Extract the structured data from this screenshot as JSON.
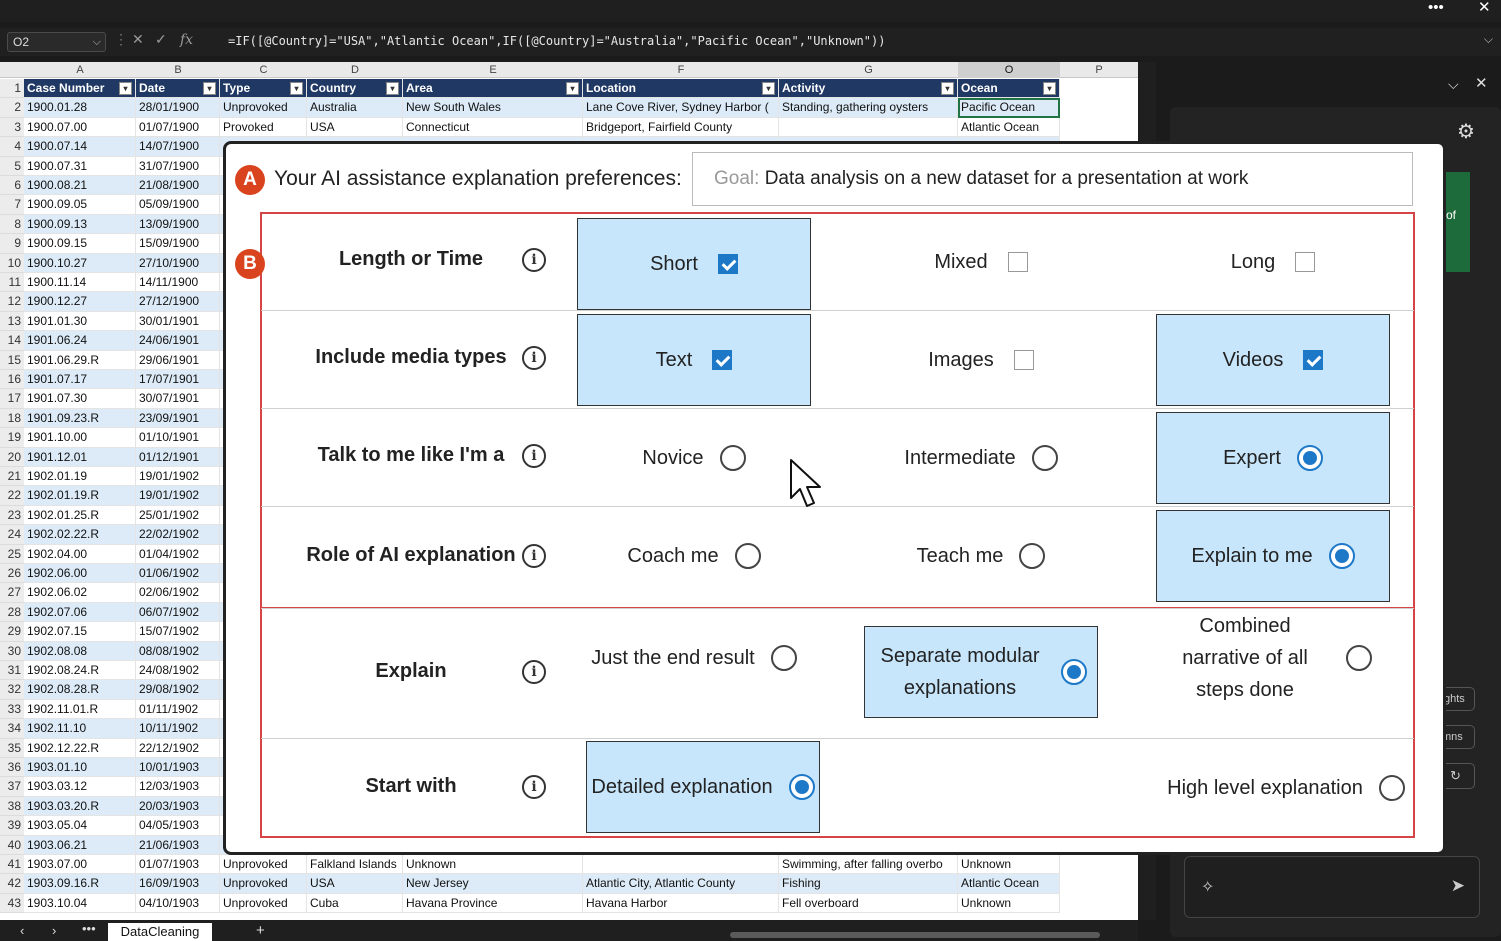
{
  "window": {
    "more_icon": "ellipsis-icon",
    "close_glyph": "✕"
  },
  "formula_bar": {
    "name_box": "O2",
    "formula": "=IF([@Country]=\"USA\",\"Atlantic Ocean\",IF([@Country]=\"Australia\",\"Pacific Ocean\",\"Unknown\"))"
  },
  "sheet": {
    "columns": [
      "A",
      "B",
      "C",
      "D",
      "E",
      "F",
      "G",
      "O",
      "P"
    ],
    "headers": [
      "Case Number",
      "Date",
      "Type",
      "Country",
      "Area",
      "Location",
      "Activity",
      "Ocean"
    ],
    "rows_top": [
      {
        "n": "1"
      },
      {
        "n": "2",
        "cells": [
          "1900.01.28",
          "28/01/1900",
          "Unprovoked",
          "Australia",
          "New South Wales",
          "Lane Cove River, Sydney Harbor (",
          "Standing, gathering oysters",
          "Pacific Ocean"
        ]
      },
      {
        "n": "3",
        "cells": [
          "1900.07.00",
          "01/07/1900",
          "Provoked",
          "USA",
          "Connecticut",
          "Bridgeport, Fairfield County",
          "",
          "Atlantic Ocean"
        ]
      }
    ],
    "rows_mid": [
      [
        "4",
        "1900.07.14",
        "14/07/1900"
      ],
      [
        "5",
        "1900.07.31",
        "31/07/1900"
      ],
      [
        "6",
        "1900.08.21",
        "21/08/1900"
      ],
      [
        "7",
        "1900.09.05",
        "05/09/1900"
      ],
      [
        "8",
        "1900.09.13",
        "13/09/1900"
      ],
      [
        "9",
        "1900.09.15",
        "15/09/1900"
      ],
      [
        "10",
        "1900.10.27",
        "27/10/1900"
      ],
      [
        "11",
        "1900.11.14",
        "14/11/1900"
      ],
      [
        "12",
        "1900.12.27",
        "27/12/1900"
      ],
      [
        "13",
        "1901.01.30",
        "30/01/1901"
      ],
      [
        "14",
        "1901.06.24",
        "24/06/1901"
      ],
      [
        "15",
        "1901.06.29.R",
        "29/06/1901"
      ],
      [
        "16",
        "1901.07.17",
        "17/07/1901"
      ],
      [
        "17",
        "1901.07.30",
        "30/07/1901"
      ],
      [
        "18",
        "1901.09.23.R",
        "23/09/1901"
      ],
      [
        "19",
        "1901.10.00",
        "01/10/1901"
      ],
      [
        "20",
        "1901.12.01",
        "01/12/1901"
      ],
      [
        "21",
        "1902.01.19",
        "19/01/1902"
      ],
      [
        "22",
        "1902.01.19.R",
        "19/01/1902"
      ],
      [
        "23",
        "1902.01.25.R",
        "25/01/1902"
      ],
      [
        "24",
        "1902.02.22.R",
        "22/02/1902"
      ],
      [
        "25",
        "1902.04.00",
        "01/04/1902"
      ],
      [
        "26",
        "1902.06.00",
        "01/06/1902"
      ],
      [
        "27",
        "1902.06.02",
        "02/06/1902"
      ],
      [
        "28",
        "1902.07.06",
        "06/07/1902"
      ],
      [
        "29",
        "1902.07.15",
        "15/07/1902"
      ],
      [
        "30",
        "1902.08.08",
        "08/08/1902"
      ],
      [
        "31",
        "1902.08.24.R",
        "24/08/1902"
      ],
      [
        "32",
        "1902.08.28.R",
        "29/08/1902"
      ],
      [
        "33",
        "1902.11.01.R",
        "01/11/1902"
      ],
      [
        "34",
        "1902.11.10",
        "10/11/1902"
      ],
      [
        "35",
        "1902.12.22.R",
        "22/12/1902"
      ],
      [
        "36",
        "1903.01.10",
        "10/01/1903"
      ],
      [
        "37",
        "1903.03.12",
        "12/03/1903"
      ],
      [
        "38",
        "1903.03.20.R",
        "20/03/1903"
      ],
      [
        "39",
        "1903.05.04",
        "04/05/1903"
      ],
      [
        "40",
        "1903.06.21",
        "21/06/1903"
      ]
    ],
    "rows_bottom": [
      {
        "n": "41",
        "cells": [
          "1903.07.00",
          "01/07/1903",
          "Unprovoked",
          "Falkland Islands",
          "Unknown",
          "",
          "Swimming, after falling overbo",
          "Unknown"
        ]
      },
      {
        "n": "42",
        "cells": [
          "1903.09.16.R",
          "16/09/1903",
          "Unprovoked",
          "USA",
          "New Jersey",
          "Atlantic City, Atlantic County",
          "Fishing",
          "Atlantic Ocean"
        ]
      },
      {
        "n": "43",
        "cells": [
          "1903.10.04",
          "04/10/1903",
          "Unprovoked",
          "Cuba",
          "Havana Province",
          "Havana Harbor",
          "Fell overboard",
          "Unknown"
        ]
      }
    ],
    "tab": "DataCleaning"
  },
  "pane": {
    "partial_texts": [
      "of",
      "ghts",
      "mns"
    ]
  },
  "prefs": {
    "badge_a": "A",
    "badge_b": "B",
    "title": "Your AI assistance explanation preferences:",
    "goal_label": "Goal:",
    "goal_text": "Data analysis on a new dataset for a presentation at work",
    "rows": [
      {
        "label": "Length or Time",
        "options": [
          "Short",
          "Mixed",
          "Long"
        ],
        "selected": [
          true,
          false,
          false
        ]
      },
      {
        "label": "Include media types",
        "options": [
          "Text",
          "Images",
          "Videos"
        ],
        "selected": [
          true,
          false,
          true
        ]
      },
      {
        "label": "Talk to me like I'm a",
        "options": [
          "Novice",
          "Intermediate",
          "Expert"
        ],
        "selected": [
          false,
          false,
          true
        ]
      },
      {
        "label": "Role of AI explanation",
        "options": [
          "Coach me",
          "Teach me",
          "Explain to me"
        ],
        "selected": [
          false,
          false,
          true
        ]
      },
      {
        "label": "Explain",
        "options": [
          "Just the end result",
          "Separate modular explanations",
          "Combined narrative of all steps done"
        ],
        "selected": [
          false,
          true,
          false
        ]
      },
      {
        "label": "Start with",
        "options": [
          "Detailed explanation",
          "High level explanation"
        ],
        "selected": [
          true,
          false
        ]
      }
    ],
    "info_glyph": "i"
  }
}
